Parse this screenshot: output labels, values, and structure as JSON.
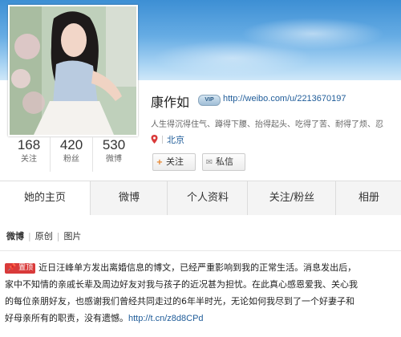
{
  "profile": {
    "name": "康作如",
    "vip_label": "VIP",
    "url": "http://weibo.com/u/2213670197",
    "motto": "人生得沉得住气、蹲得下腰、抬得起头、吃得了苦、耐得了烦、忍",
    "location": "北京",
    "follow_label": "关注",
    "message_label": "私信"
  },
  "counts": [
    {
      "num": "168",
      "label": "关注"
    },
    {
      "num": "420",
      "label": "粉丝"
    },
    {
      "num": "530",
      "label": "微博"
    }
  ],
  "tabs": [
    {
      "label": "她的主页"
    },
    {
      "label": "微博"
    },
    {
      "label": "个人资料"
    },
    {
      "label": "关注/粉丝"
    },
    {
      "label": "相册"
    }
  ],
  "feed": {
    "filters": [
      "微博",
      "原创",
      "图片"
    ],
    "pin_label": "置顶",
    "post_lines": [
      "近日汪峰单方发出离婚信息的博文，已经严重影响到我的正常生活。消息发出后，",
      "家中不知情的亲戚长辈及周边好友对我与孩子的近况甚为担忧。在此真心感恩爱我、关心我",
      "的每位亲朋好友，也感谢我们曾经共同走过的6年半时光，无论如何我尽到了一个好妻子和",
      "好母亲所有的职责，没有遗憾。"
    ],
    "post_link": "http://t.cn/z8d8CPd"
  },
  "colors": {
    "banner_top": "#3d8fd4",
    "link": "#1f5c99",
    "pin": "#d93a3a"
  }
}
